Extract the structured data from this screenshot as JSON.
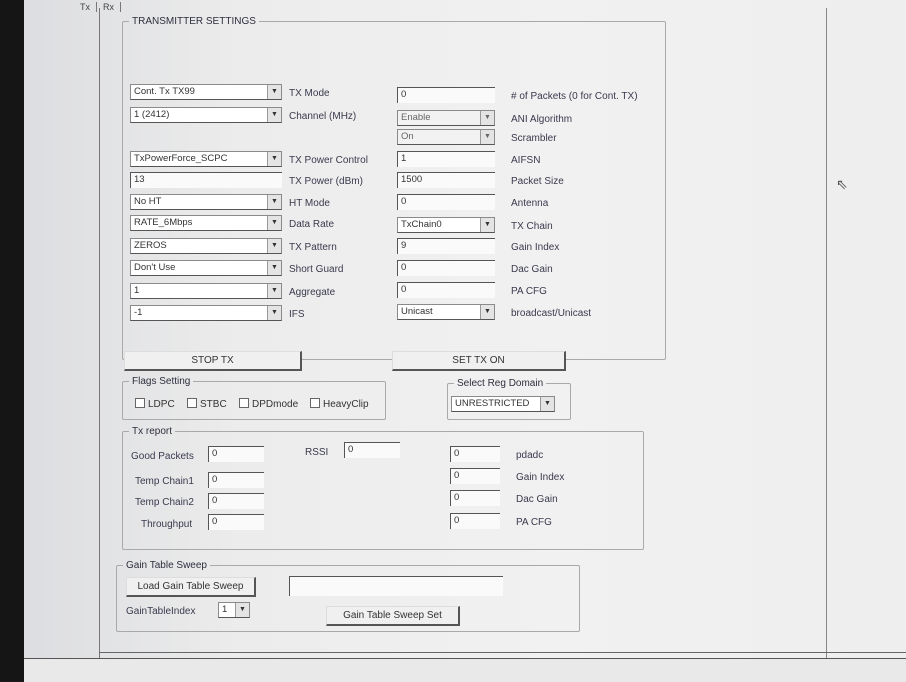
{
  "tabs": [
    "Tx",
    "Rx"
  ],
  "transmitter": {
    "title": "TRANSMITTER SETTINGS",
    "left": [
      {
        "value": "Cont. Tx TX99",
        "label": "TX Mode",
        "kind": "combo"
      },
      {
        "value": "1 (2412)",
        "label": "Channel (MHz)",
        "kind": "combo"
      },
      {
        "value": "TxPowerForce_SCPC",
        "label": "TX Power Control",
        "kind": "combo"
      },
      {
        "value": "13",
        "label": "TX Power (dBm)",
        "kind": "text"
      },
      {
        "value": "No HT",
        "label": "HT Mode",
        "kind": "combo"
      },
      {
        "value": "RATE_6Mbps",
        "label": "Data Rate",
        "kind": "combo"
      },
      {
        "value": "ZEROS",
        "label": "TX Pattern",
        "kind": "combo"
      },
      {
        "value": "Don't Use",
        "label": "Short Guard",
        "kind": "combo"
      },
      {
        "value": "1",
        "label": "Aggregate",
        "kind": "combo"
      },
      {
        "value": "-1",
        "label": "IFS",
        "kind": "combo"
      }
    ],
    "right": [
      {
        "value": "0",
        "label": "# of Packets (0 for Cont. TX)",
        "kind": "text"
      },
      {
        "value": "Enable",
        "label": "ANI Algorithm",
        "kind": "combo-grey"
      },
      {
        "value": "On",
        "label": "Scrambler",
        "kind": "combo-grey"
      },
      {
        "value": "1",
        "label": "AIFSN",
        "kind": "text"
      },
      {
        "value": "1500",
        "label": "Packet Size",
        "kind": "text"
      },
      {
        "value": "0",
        "label": "Antenna",
        "kind": "text"
      },
      {
        "value": "TxChain0",
        "label": "TX Chain",
        "kind": "combo"
      },
      {
        "value": "9",
        "label": "Gain Index",
        "kind": "text"
      },
      {
        "value": "0",
        "label": "Dac Gain",
        "kind": "text"
      },
      {
        "value": "0",
        "label": "PA CFG",
        "kind": "text"
      },
      {
        "value": "Unicast",
        "label": "broadcast/Unicast",
        "kind": "combo"
      }
    ],
    "stop_tx": "STOP TX",
    "set_tx_on": "SET TX ON"
  },
  "flags": {
    "title": "Flags Setting",
    "items": [
      "LDPC",
      "STBC",
      "DPDmode",
      "HeavyClip"
    ]
  },
  "reg_domain": {
    "title": "Select Reg Domain",
    "value": "UNRESTRICTED"
  },
  "tx_report": {
    "title": "Tx report",
    "good_packets_label": "Good Packets",
    "good_packets": "0",
    "rssi_label": "RSSI",
    "rssi": "0",
    "temp_chain1_label": "Temp Chain1",
    "temp_chain1": "0",
    "temp_chain2_label": "Temp Chain2",
    "temp_chain2": "0",
    "throughput_label": "Throughput",
    "throughput": "0",
    "right": [
      {
        "value": "0",
        "label": "pdadc"
      },
      {
        "value": "0",
        "label": "Gain Index"
      },
      {
        "value": "0",
        "label": "Dac Gain"
      },
      {
        "value": "0",
        "label": "PA CFG"
      }
    ]
  },
  "gain_sweep": {
    "title": "Gain Table Sweep",
    "load_btn": "Load Gain Table Sweep",
    "path_value": "",
    "index_label": "GainTableIndex",
    "index_value": "1",
    "set_btn": "Gain Table Sweep Set"
  }
}
